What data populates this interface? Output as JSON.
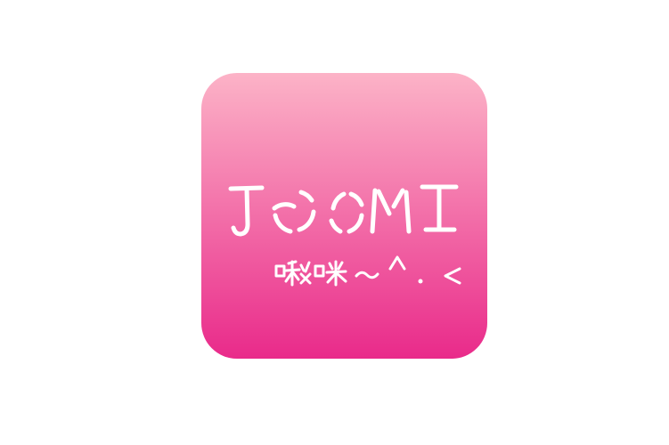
{
  "icon": {
    "logo_text": "JOOMI",
    "tagline": "啾咪~^.<",
    "colors": {
      "gradient_top": "#fcb3c7",
      "gradient_bottom": "#e92a8a",
      "text": "#ffffff"
    }
  }
}
